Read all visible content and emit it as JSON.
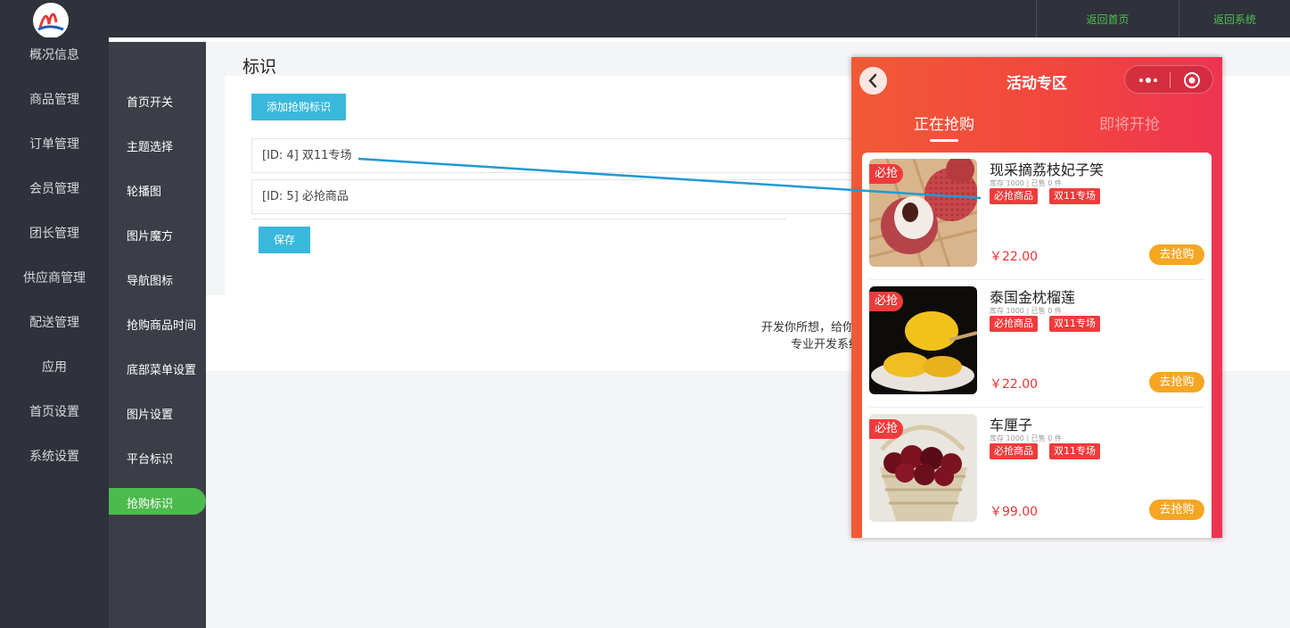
{
  "topbar": {
    "links": [
      "返回首页",
      "返回系统"
    ]
  },
  "primary_nav": [
    "概况信息",
    "商品管理",
    "订单管理",
    "会员管理",
    "团长管理",
    "供应商管理",
    "配送管理",
    "应用",
    "首页设置",
    "系统设置"
  ],
  "secondary_nav": [
    "首页开关",
    "主题选择",
    "轮播图",
    "图片魔方",
    "导航图标",
    "抢购商品时间",
    "底部菜单设置",
    "图片设置",
    "平台标识",
    "抢购标识"
  ],
  "secondary_nav_active": "抢购标识",
  "main": {
    "title": "标识",
    "add_button": "添加抢购标识",
    "rows": [
      "[ID: 4] 双11专场",
      "[ID: 5] 必抢商品"
    ],
    "save_button": "保存"
  },
  "footer": {
    "line1": "开发你所想，给你",
    "line2": "专业开发系统"
  },
  "colors": {
    "accent_green": "#4cba4c",
    "button_blue": "#3ab7dc",
    "sidebar_dark": "#2f323a",
    "phone_red": "#f2443f",
    "buy_orange": "#f5a623"
  },
  "phone": {
    "title": "活动专区",
    "tabs": [
      "正在抢购",
      "即将开抢"
    ],
    "active_tab": "正在抢购",
    "products": [
      {
        "badge": "必抢",
        "name": "现采摘荔枝妃子笑",
        "stock": "库存 1000 | 已售 0 件",
        "tags": [
          "必抢商品",
          "双11专场"
        ],
        "price": "￥22.00",
        "button": "去抢购",
        "image": "lychee"
      },
      {
        "badge": "必抢",
        "name": "泰国金枕榴莲",
        "stock": "库存 1000 | 已售 0 件",
        "tags": [
          "必抢商品",
          "双11专场"
        ],
        "price": "￥22.00",
        "button": "去抢购",
        "image": "durian"
      },
      {
        "badge": "必抢",
        "name": "车厘子",
        "stock": "库存 1000 | 已售 0 件",
        "tags": [
          "必抢商品",
          "双11专场"
        ],
        "price": "￥99.00",
        "button": "去抢购",
        "image": "cherry"
      }
    ]
  }
}
